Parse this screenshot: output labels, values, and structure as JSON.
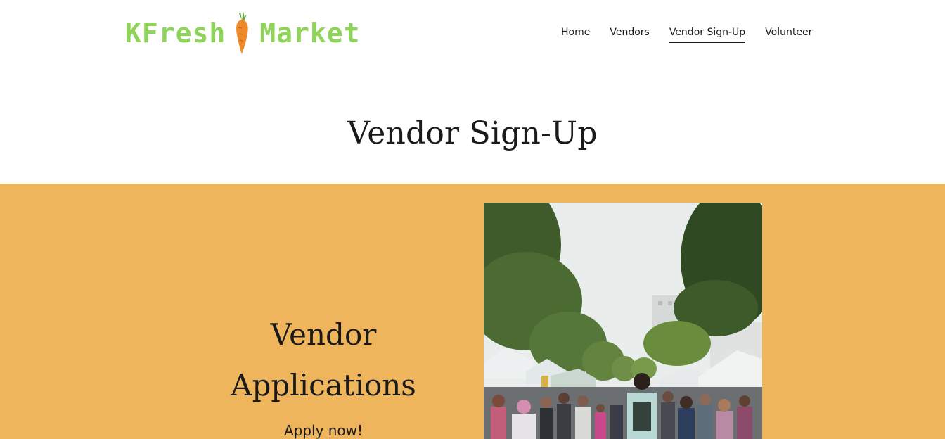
{
  "header": {
    "logo": {
      "word1": "KFresh",
      "word2": "Market"
    },
    "nav": [
      {
        "label": "Home",
        "active": false
      },
      {
        "label": "Vendors",
        "active": false
      },
      {
        "label": "Vendor Sign-Up",
        "active": true
      },
      {
        "label": "Volunteer",
        "active": false
      }
    ]
  },
  "page": {
    "title": "Vendor Sign-Up"
  },
  "section": {
    "heading_line1": "Vendor",
    "heading_line2": "Applications",
    "subtext": "Apply now!"
  },
  "colors": {
    "brand_green": "#8fd45a",
    "carrot_orange": "#ef8a2b",
    "band_orange": "#eeb55d",
    "text": "#1a1a1a"
  }
}
